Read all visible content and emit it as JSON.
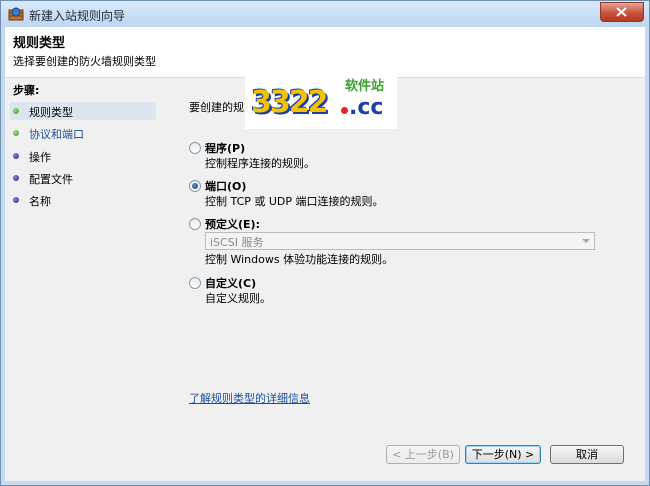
{
  "window": {
    "title": "新建入站规则向导"
  },
  "header": {
    "title": "规则类型",
    "subtitle": "选择要创建的防火墙规则类型"
  },
  "sidebar": {
    "steps_label": "步骤:",
    "items": [
      {
        "label": "规则类型",
        "state": "current"
      },
      {
        "label": "协议和端口",
        "state": "done"
      },
      {
        "label": "操作",
        "state": "pending"
      },
      {
        "label": "配置文件",
        "state": "pending"
      },
      {
        "label": "名称",
        "state": "pending"
      }
    ]
  },
  "main": {
    "prompt": "要创建的规则类型",
    "options": [
      {
        "label": "程序(P)",
        "desc": "控制程序连接的规则。",
        "checked": false
      },
      {
        "label": "端口(O)",
        "desc": "控制 TCP 或 UDP 端口连接的规则。",
        "checked": true
      },
      {
        "label": "预定义(E):",
        "desc": "控制 Windows 体验功能连接的规则。",
        "checked": false,
        "select_value": "iSCSI 服务"
      },
      {
        "label": "自定义(C)",
        "desc": "自定义规则。",
        "checked": false
      }
    ],
    "link": "了解规则类型的详细信息"
  },
  "buttons": {
    "back": "< 上一步(B)",
    "next": "下一步(N) >",
    "cancel": "取消"
  },
  "watermark": {
    "number": "3322",
    "domain": ".cc",
    "text": "软件站"
  },
  "colors": {
    "accent": "#1b4fa0",
    "step_done": "#3d9a24",
    "step_pending": "#2c2588"
  }
}
